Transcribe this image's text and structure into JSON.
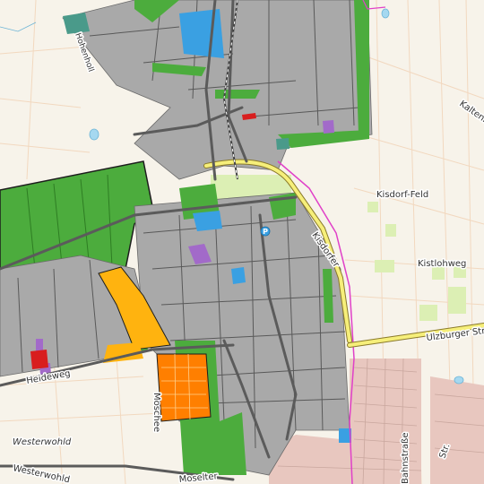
{
  "map": {
    "colors": {
      "background": "#f7f3ea",
      "landuse_industrial": "#a9a9a9",
      "landuse_green": "#4cac3d",
      "landuse_orange": "#ff7f00",
      "landuse_yellow": "#ffb30f",
      "landuse_blue": "#3aa0e2",
      "landuse_purple": "#a26ac9",
      "landuse_red": "#d81e1e",
      "residential": "#e8c7bf",
      "road_major": "#f6ef7a",
      "road_grey": "#5b5b5b",
      "rail": "#444444",
      "boundary": "#e040c8",
      "farm_stripe": "#f2d8bf",
      "light_green": "#eaf5c8"
    },
    "labels": {
      "kisdorfer": "Kisdorfer",
      "kisdorf_feld": "Kisdorf-Feld",
      "kistlohweg": "Kistlohweg",
      "ulzburger_str": "Ulzburger Str.",
      "westerwohld_1": "Westerwohld",
      "westerwohld_2": "Westerwohld",
      "heideweg": "Heideweg",
      "moschee": "Moschee",
      "moselter": "Moselter",
      "bahnstrasse": "Bahnstraße",
      "kaltenk": "Kaltenk",
      "hohenstrasse": "Hohenholl",
      "p_sign": "P",
      "strasse_abbrev": "Str."
    }
  }
}
